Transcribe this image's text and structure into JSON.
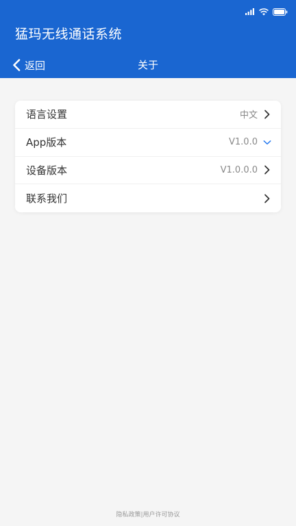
{
  "header": {
    "app_title": "猛玛无线通话系统",
    "back_label": "返回",
    "page_title": "关于",
    "background_color": "#1a66d1"
  },
  "settings": [
    {
      "label": "语言设置",
      "value": "中文",
      "icon": "chevron-right-icon"
    },
    {
      "label": "App版本",
      "value": "V1.0.0",
      "icon": "chevron-down-icon",
      "icon_color": "#2a7cf0"
    },
    {
      "label": "设备版本",
      "value": "V1.0.0.0",
      "icon": "chevron-right-icon"
    },
    {
      "label": "联系我们",
      "value": "",
      "icon": "chevron-right-icon"
    }
  ],
  "footer": {
    "privacy": "隐私政策",
    "separator": "|",
    "license": "用户许可协议"
  },
  "status_icons": [
    "signal-icon",
    "wifi-icon",
    "battery-icon"
  ]
}
